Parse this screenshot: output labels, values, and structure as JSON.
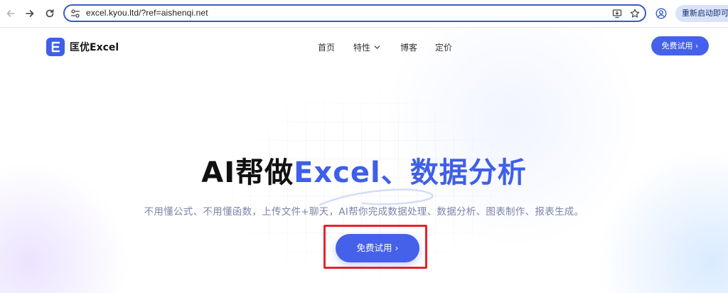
{
  "browser": {
    "url": "excel.kyou.ltd/?ref=aishenqi.net",
    "relaunch_label": "重新启动即可更新"
  },
  "site": {
    "logo_text": "匡优Excel",
    "nav": {
      "home": "首页",
      "features": "特性",
      "blog": "博客",
      "pricing": "定价"
    },
    "header_cta": "免费试用 ›"
  },
  "hero": {
    "title_part1": "AI帮做",
    "title_part2": "Excel、数据分析",
    "subtitle": "不用懂公式、不用懂函数，上传文件+聊天，AI帮你完成数据处理、数据分析、图表制作、报表生成。",
    "cta_label": "免费试用 ›"
  },
  "colors": {
    "brand": "#4561ea",
    "highlight_box": "#e8232a"
  },
  "icons": [
    "back-arrow-icon",
    "forward-arrow-icon",
    "reload-icon",
    "site-settings-icon",
    "install-app-icon",
    "bookmark-star-icon",
    "profile-icon",
    "chevron-down-icon",
    "logo-e-icon"
  ]
}
